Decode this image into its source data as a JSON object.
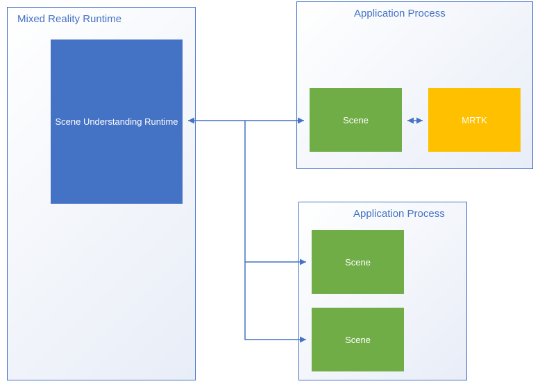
{
  "containers": {
    "runtime": {
      "title": "Mixed Reality Runtime"
    },
    "app1": {
      "title": "Application Process"
    },
    "app2": {
      "title": "Application Process"
    }
  },
  "nodes": {
    "su_runtime": {
      "label": "Scene Understanding Runtime"
    },
    "scene_app1": {
      "label": "Scene"
    },
    "mrtk": {
      "label": "MRTK"
    },
    "scene_app2a": {
      "label": "Scene"
    },
    "scene_app2b": {
      "label": "Scene"
    }
  },
  "colors": {
    "blue_fill": "#4472c4",
    "green_fill": "#70ad47",
    "orange_fill": "#ffc000",
    "border": "#4472c4",
    "arrow": "#4472c4"
  },
  "chart_data": {
    "type": "diagram",
    "title": "",
    "nodes": [
      {
        "id": "runtime_container",
        "label": "Mixed Reality Runtime",
        "type": "container"
      },
      {
        "id": "su_runtime",
        "label": "Scene Understanding Runtime",
        "parent": "runtime_container",
        "color": "#4472c4"
      },
      {
        "id": "app1_container",
        "label": "Application Process",
        "type": "container"
      },
      {
        "id": "scene1",
        "label": "Scene",
        "parent": "app1_container",
        "color": "#70ad47"
      },
      {
        "id": "mrtk",
        "label": "MRTK",
        "parent": "app1_container",
        "color": "#ffc000"
      },
      {
        "id": "app2_container",
        "label": "Application Process",
        "type": "container"
      },
      {
        "id": "scene2a",
        "label": "Scene",
        "parent": "app2_container",
        "color": "#70ad47"
      },
      {
        "id": "scene2b",
        "label": "Scene",
        "parent": "app2_container",
        "color": "#70ad47"
      }
    ],
    "edges": [
      {
        "from": "su_runtime",
        "to": "scene1",
        "bidirectional": true
      },
      {
        "from": "scene1",
        "to": "mrtk",
        "bidirectional": true
      },
      {
        "from": "su_runtime",
        "to": "scene2a",
        "bidirectional": false
      },
      {
        "from": "su_runtime",
        "to": "scene2b",
        "bidirectional": false
      }
    ]
  }
}
